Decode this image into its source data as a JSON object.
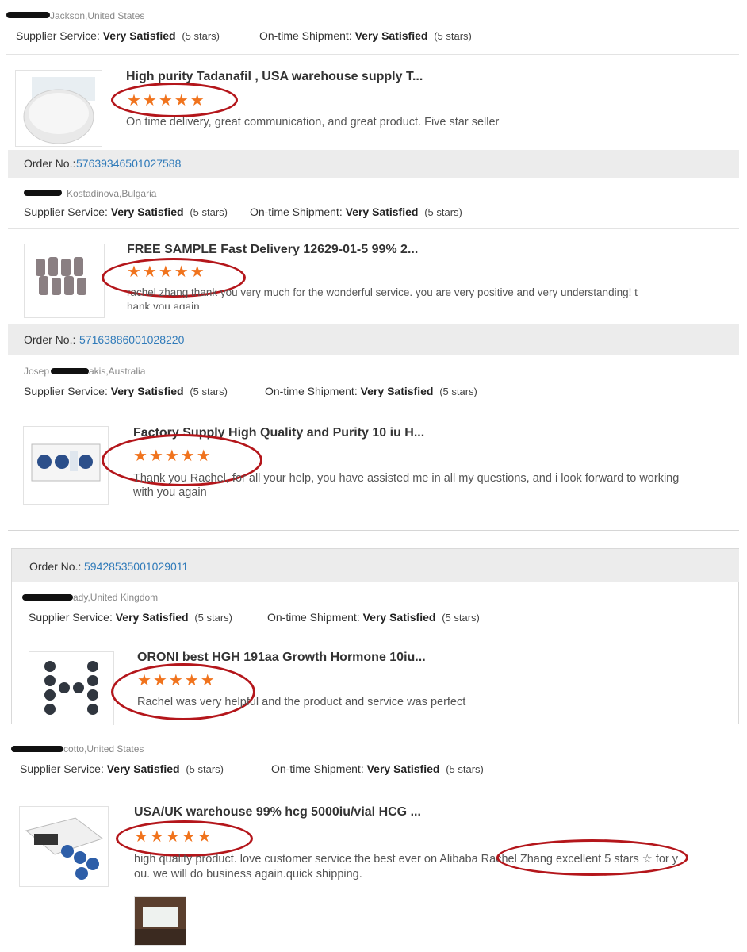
{
  "labels": {
    "supplier_service": "Supplier Service:",
    "ontime_shipment": "On-time Shipment:",
    "very_satisfied": "Very Satisfied",
    "five_stars": "(5 stars)",
    "order_no": "Order No.:"
  },
  "colors": {
    "stars": "#f0731d",
    "link": "#2f7ab9",
    "annotation": "#b4161b"
  },
  "reviews": [
    {
      "reviewer": "Jackson,United States",
      "title": "High purity Tadanafil , USA warehouse supply T...",
      "rating": 5,
      "comment": "On time delivery, great communication, and great product. Five star seller",
      "order_no": "57639346501027588"
    },
    {
      "reviewer": "Kostadinova,Bulgaria",
      "title": "FREE SAMPLE Fast Delivery 12629-01-5 99% 2...",
      "rating": 5,
      "comment": "rachel zhang thank you very much for the wonderful service. you are very positive and very understanding! t hank you again.",
      "order_no": "57163886001028220"
    },
    {
      "reviewer": "Josep",
      "reviewer_suffix": "akis,Australia",
      "title": "Factory Supply High Quality and Purity 10 iu H...",
      "rating": 5,
      "comment": "Thank you Rachel, for all your help, you have assisted me in all my questions, and i look forward to working with you again",
      "order_no": "59428535001029011"
    },
    {
      "reviewer": "ady,United Kingdom",
      "title": "ORONI best HGH 191aa Growth Hormone 10iu...",
      "rating": 5,
      "comment": "Rachel was very helpful and the product and service was perfect"
    },
    {
      "reviewer": "cotto,United States",
      "title": "USA/UK warehouse 99% hcg 5000iu/vial HCG ...",
      "rating": 5,
      "comment_part1": "high quality product. love customer service the best ever on Alibaba ",
      "comment_highlight": "Rachel Zhang excellent 5 stars",
      "comment_part2": " ☆ for y",
      "comment_line2": "ou. we will do business again.quick shipping."
    }
  ]
}
